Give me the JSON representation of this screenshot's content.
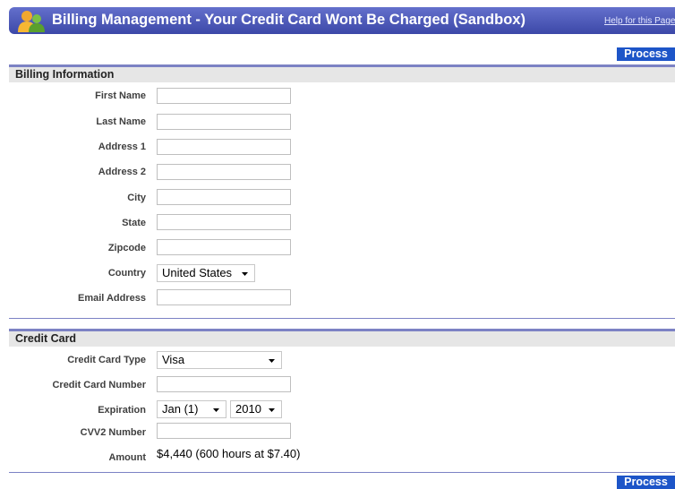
{
  "header": {
    "title": "Billing Management - Your Credit Card Wont Be Charged (Sandbox)",
    "help_link": "Help for this Page"
  },
  "actions": {
    "process_label": "Process"
  },
  "billing": {
    "title": "Billing Information",
    "fields": {
      "first_name": {
        "label": "First Name",
        "value": ""
      },
      "last_name": {
        "label": "Last Name",
        "value": ""
      },
      "address1": {
        "label": "Address 1",
        "value": ""
      },
      "address2": {
        "label": "Address 2",
        "value": ""
      },
      "city": {
        "label": "City",
        "value": ""
      },
      "state": {
        "label": "State",
        "value": ""
      },
      "zipcode": {
        "label": "Zipcode",
        "value": ""
      },
      "country": {
        "label": "Country",
        "selected": "United States"
      },
      "email": {
        "label": "Email Address",
        "value": ""
      }
    }
  },
  "credit_card": {
    "title": "Credit Card",
    "type": {
      "label": "Credit Card Type",
      "selected": "Visa"
    },
    "number": {
      "label": "Credit Card Number",
      "value": ""
    },
    "expiration": {
      "label": "Expiration",
      "month": "Jan (1)",
      "year": "2010"
    },
    "cvv2": {
      "label": "CVV2 Number",
      "value": ""
    },
    "amount": {
      "label": "Amount",
      "value": "$4,440 (600 hours at $7.40)"
    }
  },
  "colors": {
    "header_bar": "#4a56b8",
    "section_rule": "#7c82c4",
    "process_button": "#1d55c8"
  }
}
